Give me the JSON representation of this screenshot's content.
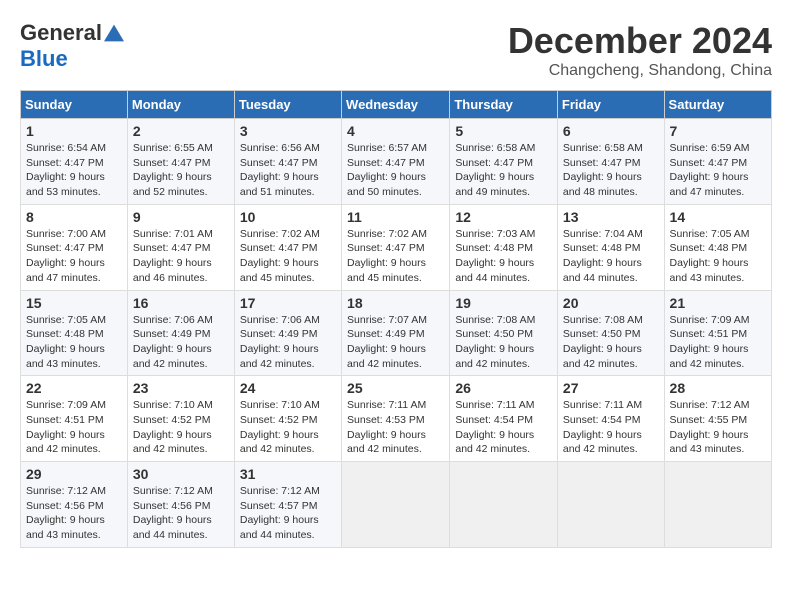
{
  "logo": {
    "general": "General",
    "blue": "Blue"
  },
  "title": "December 2024",
  "location": "Changcheng, Shandong, China",
  "days_of_week": [
    "Sunday",
    "Monday",
    "Tuesday",
    "Wednesday",
    "Thursday",
    "Friday",
    "Saturday"
  ],
  "weeks": [
    [
      {
        "day": "1",
        "sunrise": "Sunrise: 6:54 AM",
        "sunset": "Sunset: 4:47 PM",
        "daylight": "Daylight: 9 hours and 53 minutes."
      },
      {
        "day": "2",
        "sunrise": "Sunrise: 6:55 AM",
        "sunset": "Sunset: 4:47 PM",
        "daylight": "Daylight: 9 hours and 52 minutes."
      },
      {
        "day": "3",
        "sunrise": "Sunrise: 6:56 AM",
        "sunset": "Sunset: 4:47 PM",
        "daylight": "Daylight: 9 hours and 51 minutes."
      },
      {
        "day": "4",
        "sunrise": "Sunrise: 6:57 AM",
        "sunset": "Sunset: 4:47 PM",
        "daylight": "Daylight: 9 hours and 50 minutes."
      },
      {
        "day": "5",
        "sunrise": "Sunrise: 6:58 AM",
        "sunset": "Sunset: 4:47 PM",
        "daylight": "Daylight: 9 hours and 49 minutes."
      },
      {
        "day": "6",
        "sunrise": "Sunrise: 6:58 AM",
        "sunset": "Sunset: 4:47 PM",
        "daylight": "Daylight: 9 hours and 48 minutes."
      },
      {
        "day": "7",
        "sunrise": "Sunrise: 6:59 AM",
        "sunset": "Sunset: 4:47 PM",
        "daylight": "Daylight: 9 hours and 47 minutes."
      }
    ],
    [
      {
        "day": "8",
        "sunrise": "Sunrise: 7:00 AM",
        "sunset": "Sunset: 4:47 PM",
        "daylight": "Daylight: 9 hours and 47 minutes."
      },
      {
        "day": "9",
        "sunrise": "Sunrise: 7:01 AM",
        "sunset": "Sunset: 4:47 PM",
        "daylight": "Daylight: 9 hours and 46 minutes."
      },
      {
        "day": "10",
        "sunrise": "Sunrise: 7:02 AM",
        "sunset": "Sunset: 4:47 PM",
        "daylight": "Daylight: 9 hours and 45 minutes."
      },
      {
        "day": "11",
        "sunrise": "Sunrise: 7:02 AM",
        "sunset": "Sunset: 4:47 PM",
        "daylight": "Daylight: 9 hours and 45 minutes."
      },
      {
        "day": "12",
        "sunrise": "Sunrise: 7:03 AM",
        "sunset": "Sunset: 4:48 PM",
        "daylight": "Daylight: 9 hours and 44 minutes."
      },
      {
        "day": "13",
        "sunrise": "Sunrise: 7:04 AM",
        "sunset": "Sunset: 4:48 PM",
        "daylight": "Daylight: 9 hours and 44 minutes."
      },
      {
        "day": "14",
        "sunrise": "Sunrise: 7:05 AM",
        "sunset": "Sunset: 4:48 PM",
        "daylight": "Daylight: 9 hours and 43 minutes."
      }
    ],
    [
      {
        "day": "15",
        "sunrise": "Sunrise: 7:05 AM",
        "sunset": "Sunset: 4:48 PM",
        "daylight": "Daylight: 9 hours and 43 minutes."
      },
      {
        "day": "16",
        "sunrise": "Sunrise: 7:06 AM",
        "sunset": "Sunset: 4:49 PM",
        "daylight": "Daylight: 9 hours and 42 minutes."
      },
      {
        "day": "17",
        "sunrise": "Sunrise: 7:06 AM",
        "sunset": "Sunset: 4:49 PM",
        "daylight": "Daylight: 9 hours and 42 minutes."
      },
      {
        "day": "18",
        "sunrise": "Sunrise: 7:07 AM",
        "sunset": "Sunset: 4:49 PM",
        "daylight": "Daylight: 9 hours and 42 minutes."
      },
      {
        "day": "19",
        "sunrise": "Sunrise: 7:08 AM",
        "sunset": "Sunset: 4:50 PM",
        "daylight": "Daylight: 9 hours and 42 minutes."
      },
      {
        "day": "20",
        "sunrise": "Sunrise: 7:08 AM",
        "sunset": "Sunset: 4:50 PM",
        "daylight": "Daylight: 9 hours and 42 minutes."
      },
      {
        "day": "21",
        "sunrise": "Sunrise: 7:09 AM",
        "sunset": "Sunset: 4:51 PM",
        "daylight": "Daylight: 9 hours and 42 minutes."
      }
    ],
    [
      {
        "day": "22",
        "sunrise": "Sunrise: 7:09 AM",
        "sunset": "Sunset: 4:51 PM",
        "daylight": "Daylight: 9 hours and 42 minutes."
      },
      {
        "day": "23",
        "sunrise": "Sunrise: 7:10 AM",
        "sunset": "Sunset: 4:52 PM",
        "daylight": "Daylight: 9 hours and 42 minutes."
      },
      {
        "day": "24",
        "sunrise": "Sunrise: 7:10 AM",
        "sunset": "Sunset: 4:52 PM",
        "daylight": "Daylight: 9 hours and 42 minutes."
      },
      {
        "day": "25",
        "sunrise": "Sunrise: 7:11 AM",
        "sunset": "Sunset: 4:53 PM",
        "daylight": "Daylight: 9 hours and 42 minutes."
      },
      {
        "day": "26",
        "sunrise": "Sunrise: 7:11 AM",
        "sunset": "Sunset: 4:54 PM",
        "daylight": "Daylight: 9 hours and 42 minutes."
      },
      {
        "day": "27",
        "sunrise": "Sunrise: 7:11 AM",
        "sunset": "Sunset: 4:54 PM",
        "daylight": "Daylight: 9 hours and 42 minutes."
      },
      {
        "day": "28",
        "sunrise": "Sunrise: 7:12 AM",
        "sunset": "Sunset: 4:55 PM",
        "daylight": "Daylight: 9 hours and 43 minutes."
      }
    ],
    [
      {
        "day": "29",
        "sunrise": "Sunrise: 7:12 AM",
        "sunset": "Sunset: 4:56 PM",
        "daylight": "Daylight: 9 hours and 43 minutes."
      },
      {
        "day": "30",
        "sunrise": "Sunrise: 7:12 AM",
        "sunset": "Sunset: 4:56 PM",
        "daylight": "Daylight: 9 hours and 44 minutes."
      },
      {
        "day": "31",
        "sunrise": "Sunrise: 7:12 AM",
        "sunset": "Sunset: 4:57 PM",
        "daylight": "Daylight: 9 hours and 44 minutes."
      },
      null,
      null,
      null,
      null
    ]
  ]
}
